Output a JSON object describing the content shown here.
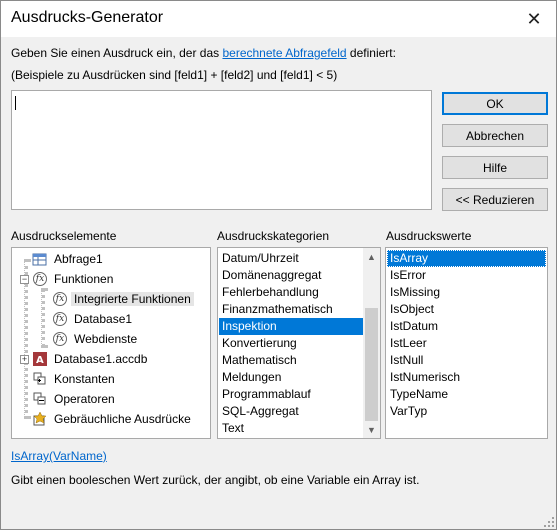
{
  "window": {
    "title": "Ausdrucks-Generator",
    "close_glyph": "✕"
  },
  "description": {
    "line1_prefix": "Geben Sie einen Ausdruck ein, der das ",
    "line1_link": "berechnete Abfragefeld",
    "line1_suffix": " definiert:",
    "line2": "(Beispiele zu Ausdrücken sind [feld1] + [feld2] und [feld1] < 5)"
  },
  "expression": {
    "value": ""
  },
  "buttons": {
    "ok": "OK",
    "cancel": "Abbrechen",
    "help": "Hilfe",
    "reduce": "<< Reduzieren"
  },
  "sections": {
    "elements_label": "Ausdruckselemente",
    "categories_label": "Ausdruckskategorien",
    "values_label": "Ausdruckswerte"
  },
  "tree": {
    "items": [
      {
        "label": "Abfrage1",
        "icon": "query-icon",
        "expander": "",
        "selected": false
      },
      {
        "label": "Funktionen",
        "icon": "function-icon",
        "expander": "−",
        "selected": false
      },
      {
        "label": "Integrierte Funktionen",
        "icon": "function-icon",
        "expander": "",
        "selected": true
      },
      {
        "label": "Database1",
        "icon": "function-icon",
        "expander": "",
        "selected": false
      },
      {
        "label": "Webdienste",
        "icon": "function-icon",
        "expander": "",
        "selected": false
      },
      {
        "label": "Database1.accdb",
        "icon": "database-icon",
        "expander": "+",
        "selected": false
      },
      {
        "label": "Konstanten",
        "icon": "constants-icon",
        "expander": "",
        "selected": false
      },
      {
        "label": "Operatoren",
        "icon": "operators-icon",
        "expander": "",
        "selected": false
      },
      {
        "label": "Gebräuchliche Ausdrücke",
        "icon": "common-expressions-icon",
        "expander": "",
        "selected": false
      }
    ]
  },
  "categories": {
    "items": [
      "Datum/Uhrzeit",
      "Domänenaggregat",
      "Fehlerbehandlung",
      "Finanzmathematisch",
      "Inspektion",
      "Konvertierung",
      "Mathematisch",
      "Meldungen",
      "Programmablauf",
      "SQL-Aggregat",
      "Text"
    ],
    "selected": "Inspektion"
  },
  "values": {
    "items": [
      "IsArray",
      "IsError",
      "IsMissing",
      "IsObject",
      "IstDatum",
      "IstLeer",
      "IstNull",
      "IstNumerisch",
      "TypeName",
      "VarTyp"
    ],
    "selected": "IsArray"
  },
  "footer": {
    "syntax": "IsArray(VarName)",
    "description": "Gibt einen booleschen Wert zurück, der angibt, ob eine Variable ein Array ist."
  },
  "colors": {
    "selection": "#0078d7",
    "link": "#0066cc"
  }
}
